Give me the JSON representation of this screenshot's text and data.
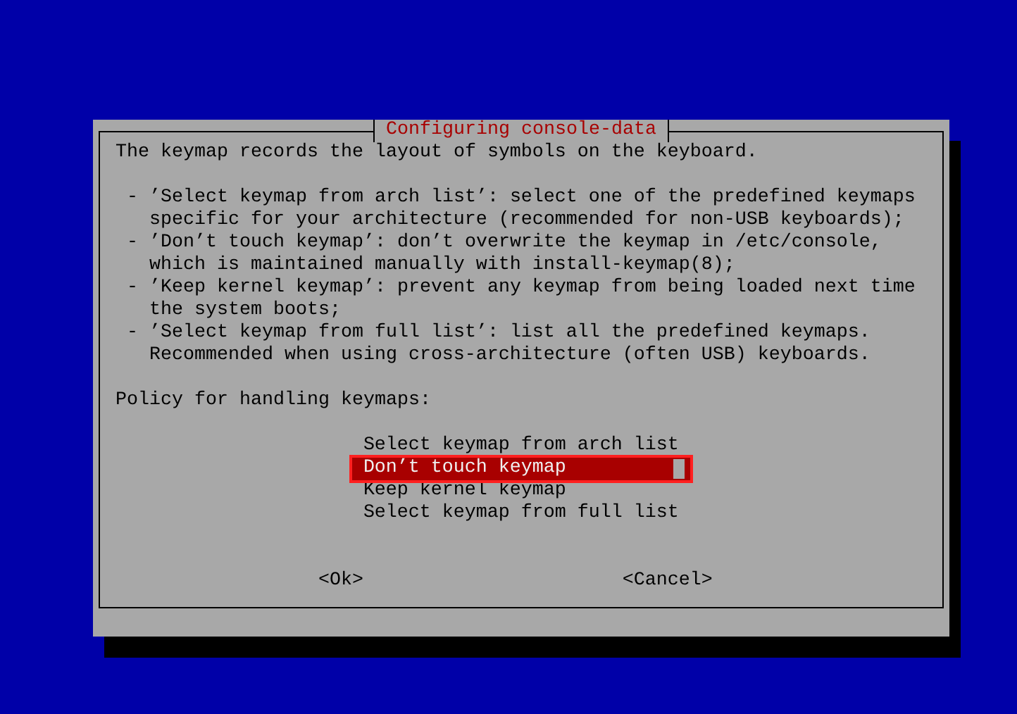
{
  "dialog": {
    "title": "Configuring console-data",
    "intro": "The keymap records the layout of symbols on the keyboard.",
    "bullets": [
      "- ’Select keymap from arch list’: select one of the predefined keymaps specific for your architecture (recommended for non-USB keyboards);",
      "- ’Don’t touch keymap’: don’t overwrite the keymap in /etc/console, which is maintained manually with install-keymap(8);",
      "- ’Keep kernel keymap’: prevent any keymap from being loaded next time the system boots;",
      "- ’Select keymap from full list’: list all the predefined keymaps. Recommended when using cross-architecture (often USB) keyboards."
    ],
    "prompt": "Policy for handling keymaps:",
    "menu": [
      {
        "label": "Select keymap from arch list",
        "selected": false
      },
      {
        "label": "Don’t touch keymap",
        "selected": true
      },
      {
        "label": "Keep kernel keymap",
        "selected": false
      },
      {
        "label": "Select keymap from full list",
        "selected": false
      }
    ],
    "buttons": [
      "<Ok>",
      "<Cancel>"
    ]
  }
}
